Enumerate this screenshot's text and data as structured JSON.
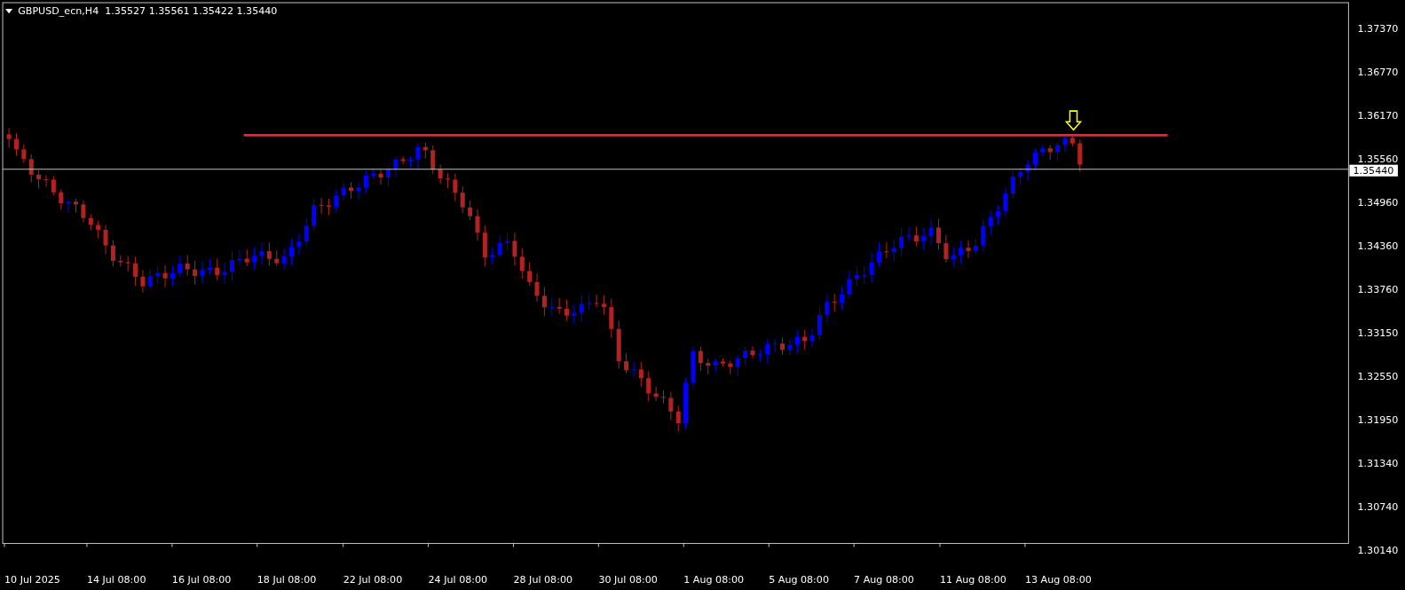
{
  "header": {
    "title": "GBPUSD_ecn,H4  1.35527 1.35561 1.35422 1.35440"
  },
  "price_axis": [
    "1.37370",
    "1.36770",
    "1.36170",
    "1.35560",
    "1.34960",
    "1.34360",
    "1.33760",
    "1.33150",
    "1.32550",
    "1.31950",
    "1.31340",
    "1.30740",
    "1.30140"
  ],
  "current_price": "1.35440",
  "time_axis": [
    "10 Jul 2025",
    "14 Jul 08:00",
    "16 Jul 08:00",
    "18 Jul 08:00",
    "22 Jul 08:00",
    "24 Jul 08:00",
    "28 Jul 08:00",
    "30 Jul 08:00",
    "1 Aug 08:00",
    "5 Aug 08:00",
    "7 Aug 08:00",
    "11 Aug 08:00",
    "13 Aug 08:00"
  ]
}
